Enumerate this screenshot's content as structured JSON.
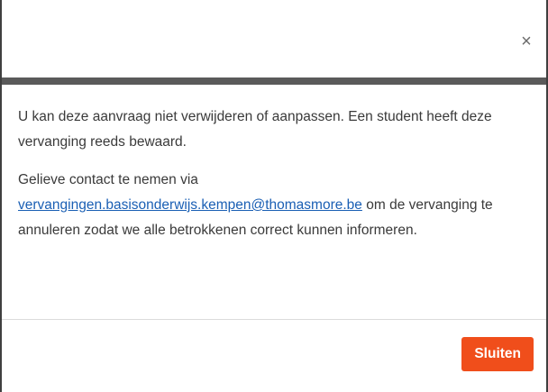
{
  "dialog": {
    "close_icon": "×",
    "close_icon_name": "close-icon",
    "header_bar_color": "#5a5a5a",
    "paragraph1": "U kan deze aanvraag niet verwijderen of aanpassen. Een student heeft deze vervanging reeds bewaard.",
    "paragraph2_prefix": "Gelieve contact te nemen via",
    "email_link": "vervangingen.basisonderwijs.kempen@thomasmore.be",
    "paragraph2_suffix": "om de vervanging te annuleren zodat we alle betrokkenen correct kunnen informeren.",
    "button_label": "Sluiten",
    "button_color": "#f04e1b"
  }
}
